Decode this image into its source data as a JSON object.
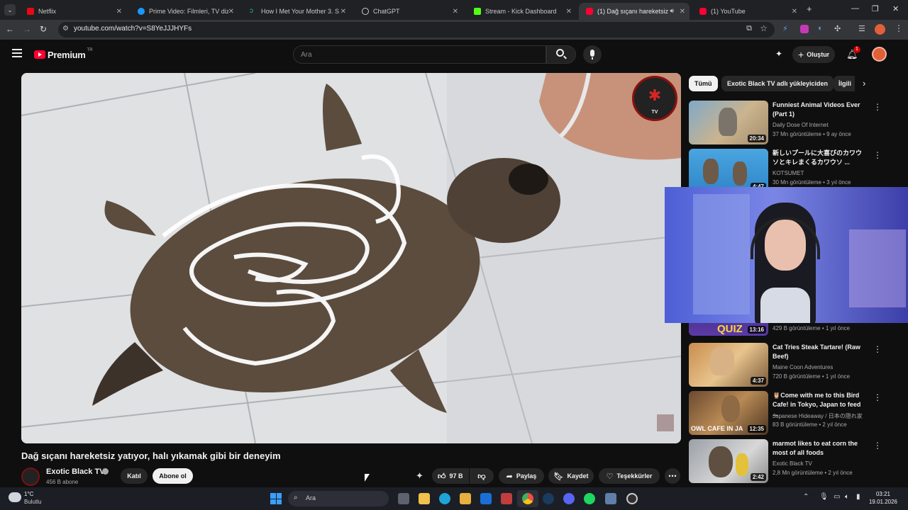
{
  "browser": {
    "tabs": [
      {
        "label": "Netflix",
        "color": "#e50914"
      },
      {
        "label": "Prime Video: Filmleri, TV dizilеr",
        "color": "#1a98ff"
      },
      {
        "label": "How I Met Your Mother 3. Sezo",
        "color": "#2bb673"
      },
      {
        "label": "ChatGPT",
        "color": "#bbbbbb"
      },
      {
        "label": "Stream - Kick Dashboard",
        "color": "#53fc18"
      },
      {
        "label": "(1) Dağ sıçanı hareketsiz ya",
        "color": "#ff0033"
      },
      {
        "label": "(1) YouTube",
        "color": "#ff0033"
      }
    ],
    "url": "youtube.com/watch?v=S8YeJJJHYFs"
  },
  "youtube": {
    "logo_text": "Premium",
    "logo_badge": "TR",
    "search_placeholder": "Ara",
    "create_label": "Oluştur",
    "notif_count": "1"
  },
  "video": {
    "title": "Dağ sıçanı hareketsiz yatıyor, halı yıkamak gibi bir deneyim",
    "channel": "Exotic Black TV",
    "subscribers": "456 B abone",
    "join_label": "Katıl",
    "subscribe_label": "Abone ol",
    "likes": "97 B",
    "share_label": "Paylaş",
    "save_label": "Kaydet",
    "thanks_label": "Teşekkürler",
    "watermark_text": "TV"
  },
  "chips": [
    "Tümü",
    "Exotic Black TV adlı yükleyiciden",
    "İlgili"
  ],
  "recommendations": [
    {
      "title": "Funniest Animal Videos Ever (Part 1)",
      "channel": "Daily Dose Of Internet",
      "meta": "37 Mn görüntüleme • 9 ay önce",
      "duration": "20:34"
    },
    {
      "title": "新しいプールに大喜びのカワウソとキレまくるカワウソ ...",
      "channel": "KOTSUMET",
      "meta": "30 Mn görüntüleme • 3 yıl önce",
      "duration": "4:47"
    },
    {
      "title": "",
      "channel": "",
      "meta": "429 B görüntüleme • 1 yıl önce",
      "duration": "13:16",
      "overlay": "QUIZ"
    },
    {
      "title": "Cat Tries Steak Tartare! (Raw Beef)",
      "channel": "Maine Coon Adventures",
      "meta": "720 B görüntüleme • 1 yıl önce",
      "duration": "4:37"
    },
    {
      "title": "🦉Come with me to this Bird Cafe! in Tokyo, Japan to feed ...",
      "channel": "Japanese Hideaway / 日本の隠れ家",
      "meta": "83 B görüntüleme • 2 yıl önce",
      "duration": "12:35",
      "overlay": "OWL CAFE IN JA"
    },
    {
      "title": "marmot likes to eat corn the most of all foods",
      "channel": "Exotic Black TV",
      "meta": "2,8 Mn görüntüleme • 2 yıl önce",
      "duration": "2:42"
    }
  ],
  "taskbar": {
    "weather_temp": "1°C",
    "weather_desc": "Bulutlu",
    "search_label": "Ara",
    "time": "03:21",
    "date": "19.01.2026"
  }
}
